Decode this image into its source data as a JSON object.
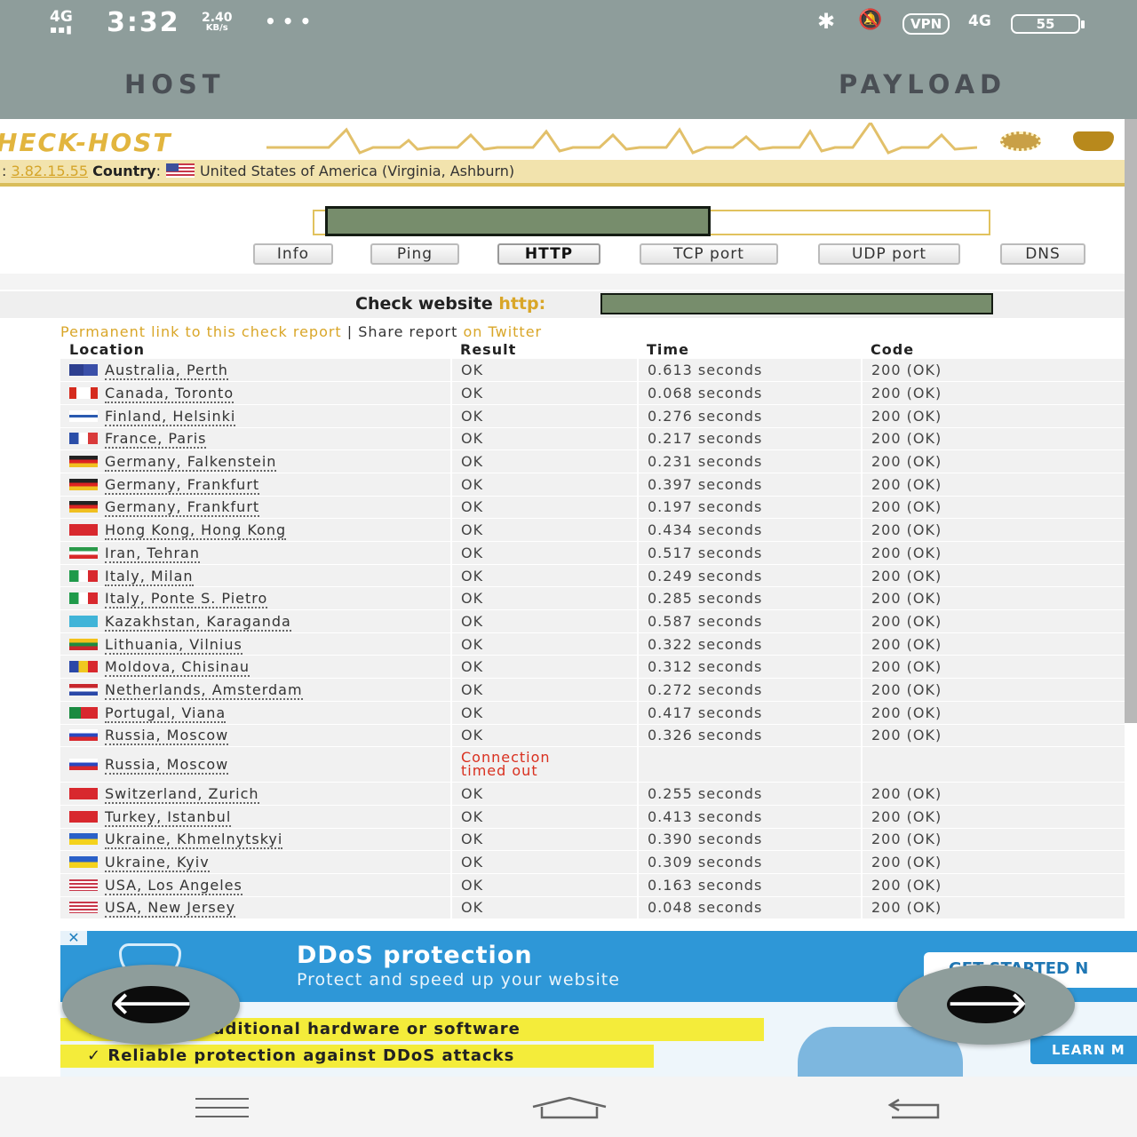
{
  "status_bar": {
    "signal": "4G",
    "time": "3:32",
    "speed_value": "2.40",
    "speed_unit": "KB/s",
    "dots": "• • •",
    "vpn": "VPN",
    "network": "4G",
    "battery": "55",
    "icons": [
      "bluetooth-icon",
      "mute-icon"
    ]
  },
  "app_tabs": {
    "host": "HOST",
    "payload": "PAYLOAD"
  },
  "site": {
    "logo": "HECK-HOST",
    "ip_prefix": ": ",
    "ip": "3.82.15.55",
    "country_label": "Country",
    "country": "United States of America (Virginia, Ashburn)"
  },
  "tools": [
    "Info",
    "Ping",
    "HTTP",
    "TCP port",
    "UDP port",
    "DNS"
  ],
  "active_tool": "HTTP",
  "check": {
    "label": "Check website",
    "protocol": "http:"
  },
  "links": {
    "permanent": "Permanent link to this check report",
    "separator": " | ",
    "share": "Share report",
    "twitter": "on Twitter"
  },
  "table": {
    "headers": [
      "Location",
      "Result",
      "Time",
      "Code"
    ],
    "rows": [
      {
        "location": "Australia, Perth",
        "result": "OK",
        "time": "0.613 seconds",
        "code": "200 (OK)",
        "flag": "au"
      },
      {
        "location": "Canada, Toronto",
        "result": "OK",
        "time": "0.068 seconds",
        "code": "200 (OK)",
        "flag": "ca"
      },
      {
        "location": "Finland, Helsinki",
        "result": "OK",
        "time": "0.276 seconds",
        "code": "200 (OK)",
        "flag": "fi"
      },
      {
        "location": "France, Paris",
        "result": "OK",
        "time": "0.217 seconds",
        "code": "200 (OK)",
        "flag": "fr"
      },
      {
        "location": "Germany, Falkenstein",
        "result": "OK",
        "time": "0.231 seconds",
        "code": "200 (OK)",
        "flag": "de"
      },
      {
        "location": "Germany, Frankfurt",
        "result": "OK",
        "time": "0.397 seconds",
        "code": "200 (OK)",
        "flag": "de"
      },
      {
        "location": "Germany, Frankfurt",
        "result": "OK",
        "time": "0.197 seconds",
        "code": "200 (OK)",
        "flag": "de"
      },
      {
        "location": "Hong Kong, Hong Kong",
        "result": "OK",
        "time": "0.434 seconds",
        "code": "200 (OK)",
        "flag": "hk"
      },
      {
        "location": "Iran, Tehran",
        "result": "OK",
        "time": "0.517 seconds",
        "code": "200 (OK)",
        "flag": "ir"
      },
      {
        "location": "Italy, Milan",
        "result": "OK",
        "time": "0.249 seconds",
        "code": "200 (OK)",
        "flag": "it"
      },
      {
        "location": "Italy, Ponte S. Pietro",
        "result": "OK",
        "time": "0.285 seconds",
        "code": "200 (OK)",
        "flag": "it"
      },
      {
        "location": "Kazakhstan, Karaganda",
        "result": "OK",
        "time": "0.587 seconds",
        "code": "200 (OK)",
        "flag": "kz"
      },
      {
        "location": "Lithuania, Vilnius",
        "result": "OK",
        "time": "0.322 seconds",
        "code": "200 (OK)",
        "flag": "lt"
      },
      {
        "location": "Moldova, Chisinau",
        "result": "OK",
        "time": "0.312 seconds",
        "code": "200 (OK)",
        "flag": "md"
      },
      {
        "location": "Netherlands, Amsterdam",
        "result": "OK",
        "time": "0.272 seconds",
        "code": "200 (OK)",
        "flag": "nl"
      },
      {
        "location": "Portugal, Viana",
        "result": "OK",
        "time": "0.417 seconds",
        "code": "200 (OK)",
        "flag": "pt"
      },
      {
        "location": "Russia, Moscow",
        "result": "OK",
        "time": "0.326 seconds",
        "code": "200 (OK)",
        "flag": "ru"
      },
      {
        "location": "Russia, Moscow",
        "result": "Connection timed out",
        "time": "",
        "code": "",
        "flag": "ru",
        "error": true
      },
      {
        "location": "Switzerland, Zurich",
        "result": "OK",
        "time": "0.255 seconds",
        "code": "200 (OK)",
        "flag": "ch"
      },
      {
        "location": "Turkey, Istanbul",
        "result": "OK",
        "time": "0.413 seconds",
        "code": "200 (OK)",
        "flag": "tr"
      },
      {
        "location": "Ukraine, Khmelnytskyi",
        "result": "OK",
        "time": "0.390 seconds",
        "code": "200 (OK)",
        "flag": "ua"
      },
      {
        "location": "Ukraine, Kyiv",
        "result": "OK",
        "time": "0.309 seconds",
        "code": "200 (OK)",
        "flag": "ua"
      },
      {
        "location": "USA, Los Angeles",
        "result": "OK",
        "time": "0.163 seconds",
        "code": "200 (OK)",
        "flag": "us"
      },
      {
        "location": "USA, New Jersey",
        "result": "OK",
        "time": "0.048 seconds",
        "code": "200 (OK)",
        "flag": "us"
      }
    ]
  },
  "ad": {
    "close": "✕",
    "title": "DDoS protection",
    "subtitle": "Protect and speed up your website",
    "cta_top": "GET STARTED N",
    "line1": "d to install additional hardware or software",
    "line2": "✓  Reliable protection against DDoS attacks",
    "cta_bottom": "LEARN M"
  },
  "fab": {
    "left": "🡐",
    "right": "🡒"
  },
  "colors": {
    "status_bg": "#8e9d9b",
    "accent_gold": "#d9a628",
    "error_red": "#d9301f",
    "ad_blue": "#2e97d7"
  }
}
